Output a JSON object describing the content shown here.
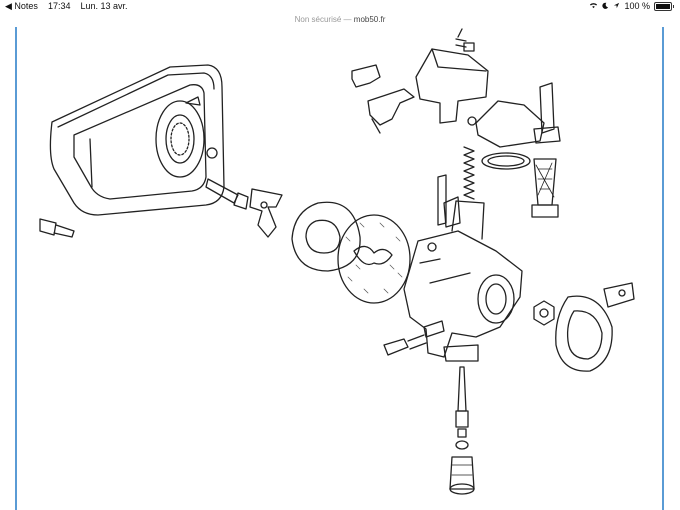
{
  "status_bar": {
    "back_app": "◀ Notes",
    "time": "17:34",
    "date": "Lun. 13 avr.",
    "battery_text": "100 %"
  },
  "url_bar": {
    "security": "Non sécurisé —",
    "domain": "mob50.fr"
  },
  "colors": {
    "accent_line": "#5a9bd5",
    "drawing": "#222222"
  },
  "icons": [
    "wifi-icon",
    "moon-icon",
    "location-icon",
    "battery-icon"
  ]
}
